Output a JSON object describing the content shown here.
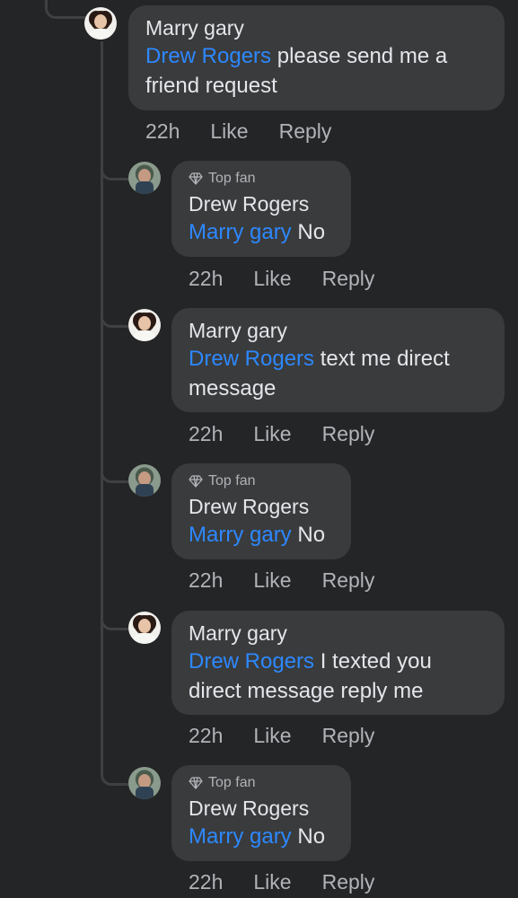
{
  "colors": {
    "background": "#242526",
    "bubble": "#3a3b3c",
    "mention": "#2d88ff",
    "text": "#e4e6eb",
    "secondary": "#b0b3b8"
  },
  "icons": {
    "badge": "diamond-icon"
  },
  "comments": [
    {
      "author": "Marry gary",
      "mention": "Drew Rogers",
      "text_line1": "please send me a",
      "text_line2": "friend request",
      "time": "22h",
      "like": "Like",
      "reply": "Reply"
    },
    {
      "badge": "Top fan",
      "author": "Drew Rogers",
      "mention": "Marry gary",
      "text_line1": "No",
      "time": "22h",
      "like": "Like",
      "reply": "Reply"
    },
    {
      "author": "Marry gary",
      "mention": "Drew Rogers",
      "text_line1": "text me direct",
      "text_line2": "message",
      "time": "22h",
      "like": "Like",
      "reply": "Reply"
    },
    {
      "badge": "Top fan",
      "author": "Drew Rogers",
      "mention": "Marry gary",
      "text_line1": "No",
      "time": "22h",
      "like": "Like",
      "reply": "Reply"
    },
    {
      "author": "Marry gary",
      "mention": "Drew Rogers",
      "text_line1": "I texted you",
      "text_line2": "direct message reply me",
      "time": "22h",
      "like": "Like",
      "reply": "Reply"
    },
    {
      "badge": "Top fan",
      "author": "Drew Rogers",
      "mention": "Marry gary",
      "text_line1": "No",
      "time": "22h",
      "like": "Like",
      "reply": "Reply"
    }
  ]
}
